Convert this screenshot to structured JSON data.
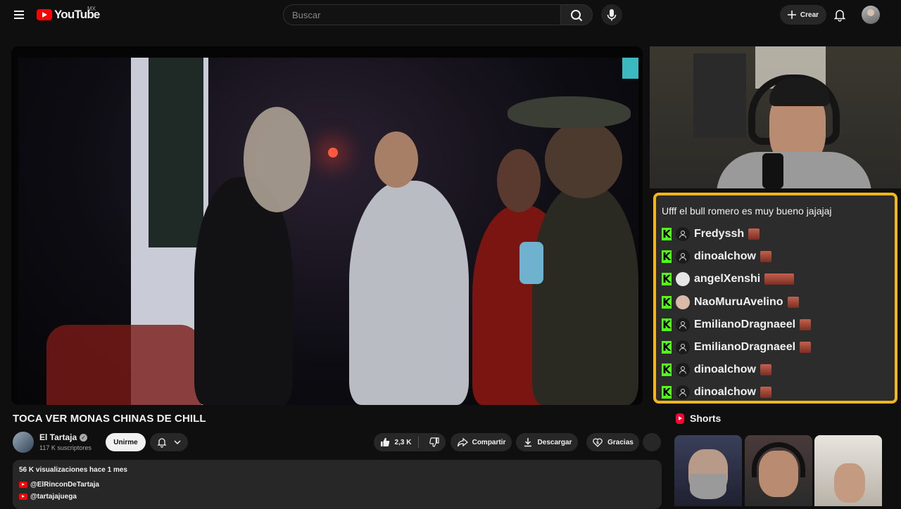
{
  "header": {
    "logo_text": "YouTube",
    "region": "MX",
    "search_placeholder": "Buscar",
    "create_label": "Crear"
  },
  "video": {
    "title": "TOCA VER MONAS CHINAS DE CHILL",
    "channel_name": "El Tartaja",
    "subscribers": "117 K suscriptores",
    "join_label": "Unirme",
    "likes": "2,3 K",
    "share_label": "Compartir",
    "download_label": "Descargar",
    "thanks_label": "Gracias"
  },
  "description": {
    "stats": "56 K visualizaciones  hace 1 mes",
    "links": [
      "@ElRinconDeTartaja",
      "@tartajajuega"
    ]
  },
  "overlay_chat": {
    "message": "Ufff el bull romero es muy bueno jajajaj",
    "users": [
      "Fredyssh",
      "dinoalchow",
      "angelXenshi",
      "NaoMuruAvelino",
      "EmilianoDragnaeel",
      "EmilianoDragnaeel",
      "dinoalchow",
      "dinoalchow"
    ],
    "border_color": "#f4b61a",
    "kick_color": "#53fc18"
  },
  "shorts": {
    "heading": "Shorts"
  }
}
